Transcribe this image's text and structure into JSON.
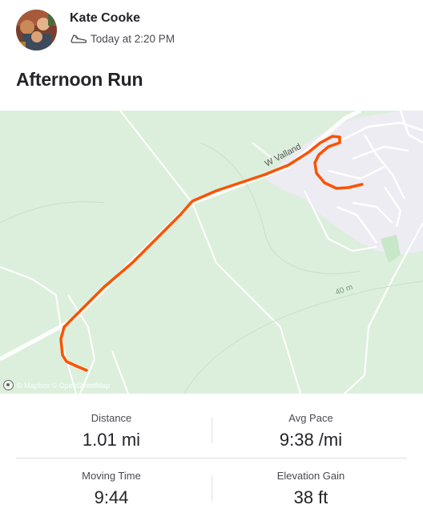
{
  "athlete": {
    "name": "Kate Cooke",
    "timestamp": "Today at 2:20 PM",
    "activity_icon": "running-shoe-icon",
    "avatar_icon": "avatar-photo"
  },
  "activity": {
    "title": "Afternoon Run"
  },
  "map": {
    "road_label": "W Valland",
    "contour_label": "40 m",
    "attribution": "© Mapbox © OpenStreetMap",
    "route_color": "#fc5200",
    "land_color": "#dcefdc",
    "settlement_color": "#ececf2"
  },
  "stats": {
    "distance": {
      "label": "Distance",
      "value": "1.01 mi"
    },
    "avg_pace": {
      "label": "Avg Pace",
      "value": "9:38 /mi"
    },
    "moving_time": {
      "label": "Moving Time",
      "value": "9:44"
    },
    "elevation_gain": {
      "label": "Elevation Gain",
      "value": "38 ft"
    }
  }
}
